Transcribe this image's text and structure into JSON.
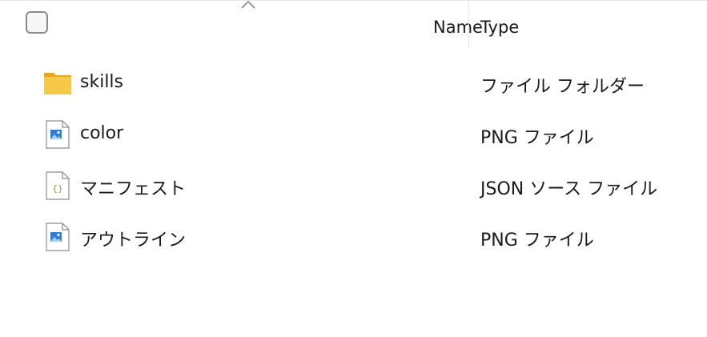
{
  "columns": {
    "name_label": "Name",
    "type_label": "Type"
  },
  "files": [
    {
      "name": "skills",
      "type": "ファイル フォルダー",
      "icon": "folder-icon"
    },
    {
      "name": "color",
      "type": "PNG ファイル",
      "icon": "png-file-icon"
    },
    {
      "name": "マニフェスト",
      "type": "JSON ソース ファイル",
      "icon": "json-file-icon"
    },
    {
      "name": "アウトライン",
      "type": "PNG ファイル",
      "icon": "png-file-icon"
    }
  ],
  "colors": {
    "folder": "#f7c948",
    "image_accent": "#2f7bd6"
  }
}
